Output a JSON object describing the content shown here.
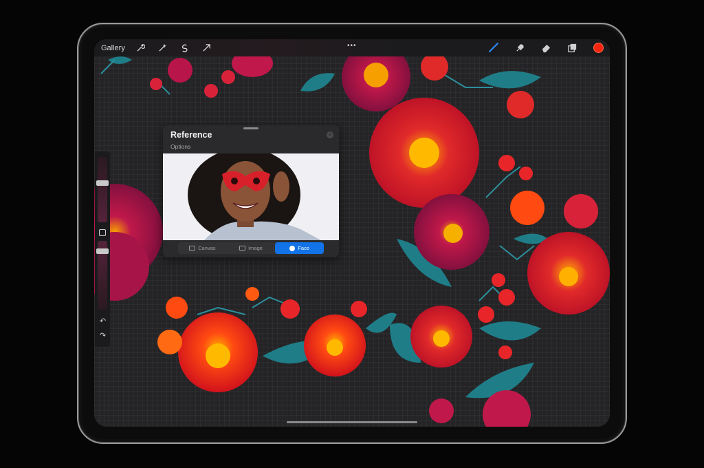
{
  "topbar": {
    "gallery_label": "Gallery",
    "tools_left": [
      {
        "icon": "wrench-icon"
      },
      {
        "icon": "magic-wand-icon"
      },
      {
        "icon": "selection-icon"
      },
      {
        "icon": "transform-arrow-icon"
      }
    ],
    "center_menu": "•••",
    "tools_right": [
      {
        "icon": "brush-icon",
        "active": true
      },
      {
        "icon": "smudge-icon"
      },
      {
        "icon": "eraser-icon"
      },
      {
        "icon": "layers-icon"
      }
    ],
    "current_color": "#f4250f",
    "accent_color": "#1273e8"
  },
  "sidebar": {
    "undo": "↶",
    "redo": "↷"
  },
  "reference_panel": {
    "title": "Reference",
    "options_label": "Options",
    "tabs": [
      {
        "label": "Canvas",
        "active": false
      },
      {
        "label": "Image",
        "active": false
      },
      {
        "label": "Face",
        "active": true
      }
    ]
  }
}
